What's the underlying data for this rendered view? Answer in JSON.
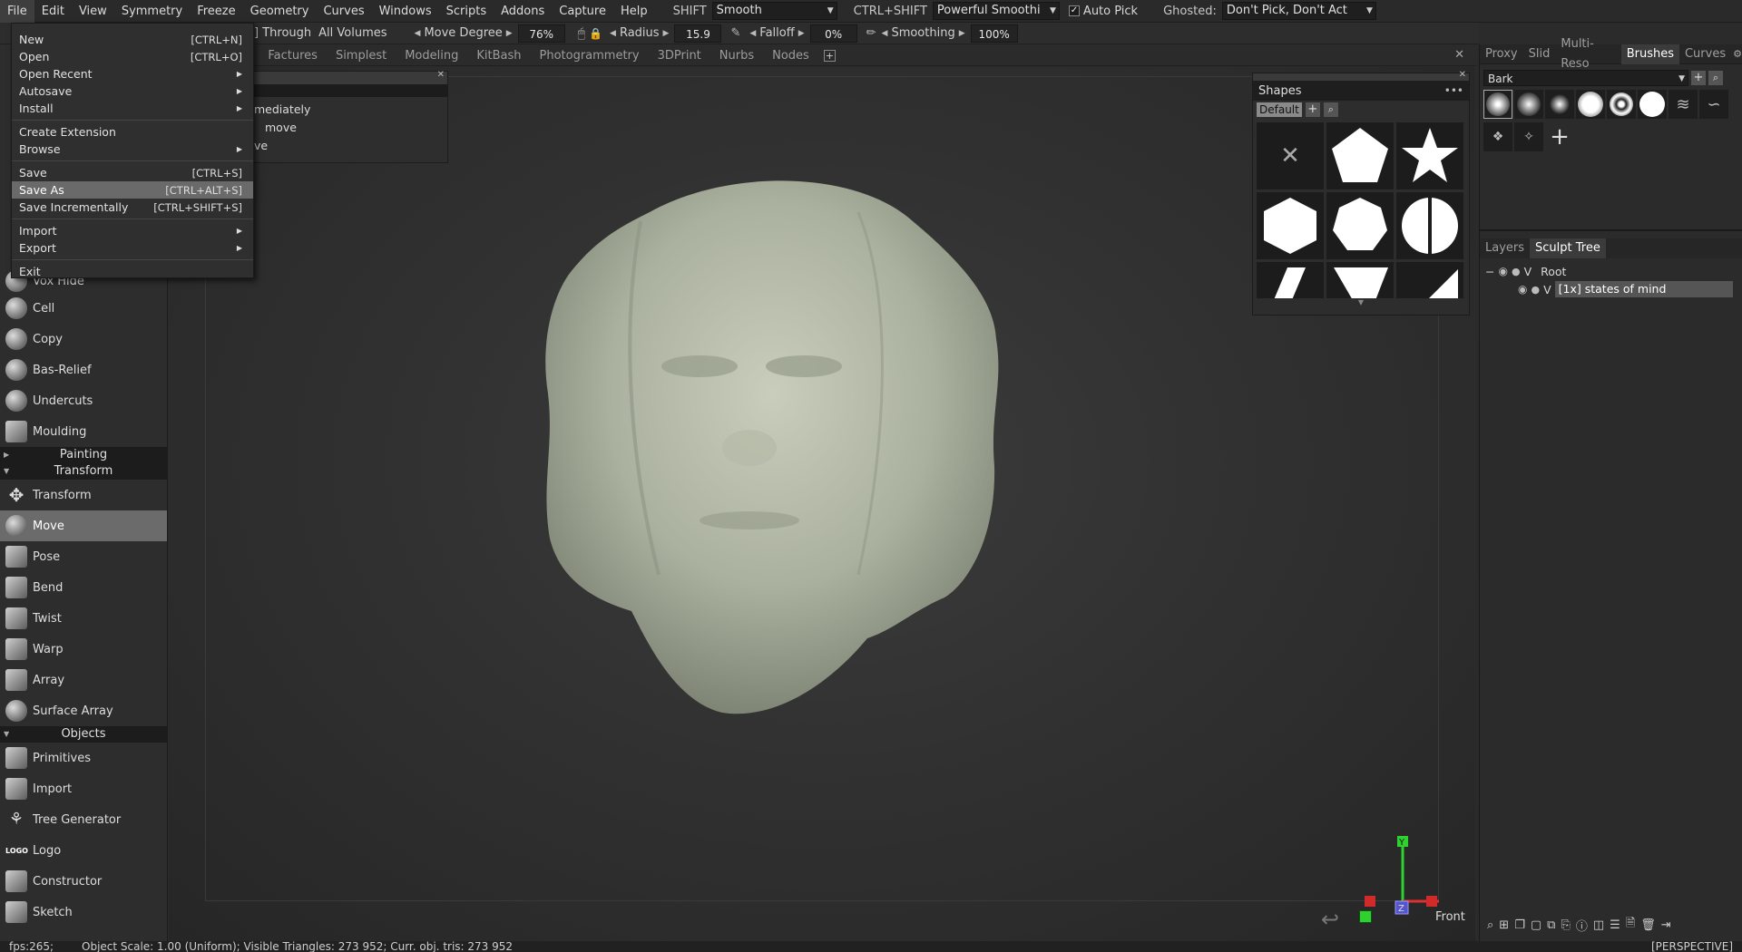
{
  "menubar": {
    "items": [
      "File",
      "Edit",
      "View",
      "Symmetry",
      "Freeze",
      "Geometry",
      "Curves",
      "Windows",
      "Scripts",
      "Addons",
      "Capture",
      "Help"
    ],
    "shift_label": "SHIFT",
    "shift_value": "Smooth",
    "ctrlshift_label": "CTRL+SHIFT",
    "ctrlshift_value": "Powerful Smoothi",
    "autopick_label": "Auto Pick",
    "ghosted_label": "Ghosted:",
    "ghosted_value": "Don't Pick, Don't Act"
  },
  "toolbar": {
    "through_label": "] Through",
    "all_volumes": "All Volumes",
    "move_degree_label": "Move Degree",
    "move_degree_value": "76%",
    "radius_label": "Radius",
    "radius_value": "15.9",
    "falloff_label": "Falloff",
    "falloff_value": "0%",
    "smoothing_label": "Smoothing",
    "smoothing_value": "100%"
  },
  "workspace_tabs": [
    "r",
    "Factures",
    "Simplest",
    "Modeling",
    "KitBash",
    "Photogrammetry",
    "3DPrint",
    "Nurbs",
    "Nodes"
  ],
  "file_menu": {
    "groups": [
      [
        {
          "label": "New",
          "shortcut": "[CTRL+N]"
        },
        {
          "label": "Open",
          "shortcut": "[CTRL+O]"
        },
        {
          "label": "Open Recent",
          "submenu": true
        },
        {
          "label": "Autosave",
          "submenu": true
        },
        {
          "label": "Install",
          "submenu": true
        }
      ],
      [
        {
          "label": "Create Extension"
        },
        {
          "label": "Browse",
          "submenu": true
        }
      ],
      [
        {
          "label": "Save",
          "shortcut": "[CTRL+S]"
        },
        {
          "label": "Save As",
          "shortcut": "[CTRL+ALT+S]",
          "highlighted": true
        },
        {
          "label": "Save Incrementally",
          "shortcut": "[CTRL+SHIFT+S]"
        }
      ],
      [
        {
          "label": "Import",
          "submenu": true
        },
        {
          "label": "Export",
          "submenu": true
        }
      ],
      [
        {
          "label": "Exit"
        }
      ]
    ]
  },
  "options_panel": {
    "line1": "mediately",
    "line2": "move",
    "line3": "ve"
  },
  "left_tools": {
    "group1": [
      "Vox Hide",
      "Cell",
      "Copy",
      "Bas-Relief",
      "Undercuts",
      "Moulding"
    ],
    "section_painting": "Painting",
    "section_transform": "Transform",
    "transform_tools": [
      "Transform",
      "Move",
      "Pose",
      "Bend",
      "Twist",
      "Warp",
      "Array",
      "Surface Array"
    ],
    "selected_tool": "Move",
    "section_objects": "Objects",
    "object_tools": [
      "Primitives",
      "Import",
      "Tree Generator",
      "Logo",
      "Constructor",
      "Sketch"
    ],
    "logo_icon_text": "LOGO"
  },
  "shapes_panel": {
    "title": "Shapes",
    "preset": "Default"
  },
  "right_panel": {
    "tabs": [
      "Proxy",
      "Slid",
      "Multi-Reso",
      "Brushes",
      "Curves"
    ],
    "active_tab": "Brushes",
    "brush_preset": "Bark",
    "tree_tabs": [
      "Layers",
      "Sculpt Tree"
    ],
    "active_tree_tab": "Sculpt Tree",
    "root_label": "Root",
    "volume_label": "[1x] states of mind",
    "visibility_letter": "V"
  },
  "gizmo": {
    "y": "Y",
    "z": "Z",
    "view_label": "Front"
  },
  "status": {
    "left": "fps:265;",
    "middle": "Object Scale: 1.00 (Uniform); Visible Triangles: 273 952; Curr. obj. tris: 273 952",
    "right": "[PERSPECTIVE]"
  },
  "colors": {
    "accent_selected": "#6b6b6b",
    "axis_y": "#2fd12f",
    "axis_x": "#e03030",
    "axis_z": "#5555cc",
    "model": "#b9bfae"
  }
}
